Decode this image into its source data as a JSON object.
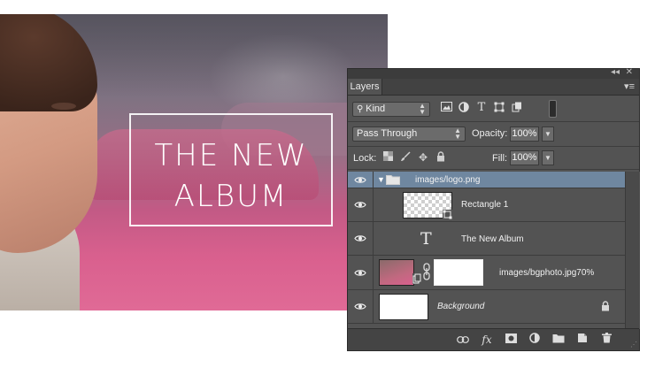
{
  "canvas": {
    "logo_line1": "THE NEW",
    "logo_line2": "ALBUM"
  },
  "panel": {
    "top_controls": {
      "collapse": "◂◂",
      "close": "✕"
    },
    "tab_label": "Layers",
    "menu_icon": "panel-menu-icon",
    "filter": {
      "kind_label": "Kind",
      "icons": [
        "pixel-filter-icon",
        "adjustment-filter-icon",
        "type-filter-icon",
        "shape-filter-icon",
        "smart-object-filter-icon"
      ]
    },
    "blend_mode": "Pass Through",
    "opacity_label": "Opacity:",
    "opacity_value": "100%",
    "lock_label": "Lock:",
    "fill_label": "Fill:",
    "fill_value": "100%",
    "layers": [
      {
        "name": "images/logo.png",
        "type": "group",
        "selected": true
      },
      {
        "name": "Rectangle 1",
        "type": "shape"
      },
      {
        "name": "The New Album",
        "type": "text"
      },
      {
        "name": "images/bgphoto.jpg70%",
        "type": "pixel-with-mask"
      },
      {
        "name": "Background",
        "type": "background",
        "locked": true
      }
    ],
    "footer_icons": [
      "link-layers-icon",
      "fx-icon",
      "add-mask-icon",
      "adjustment-layer-icon",
      "new-group-icon",
      "new-layer-icon",
      "delete-layer-icon"
    ],
    "colors": {
      "panel_bg": "#535353",
      "selected_row": "#6f87a0"
    }
  }
}
